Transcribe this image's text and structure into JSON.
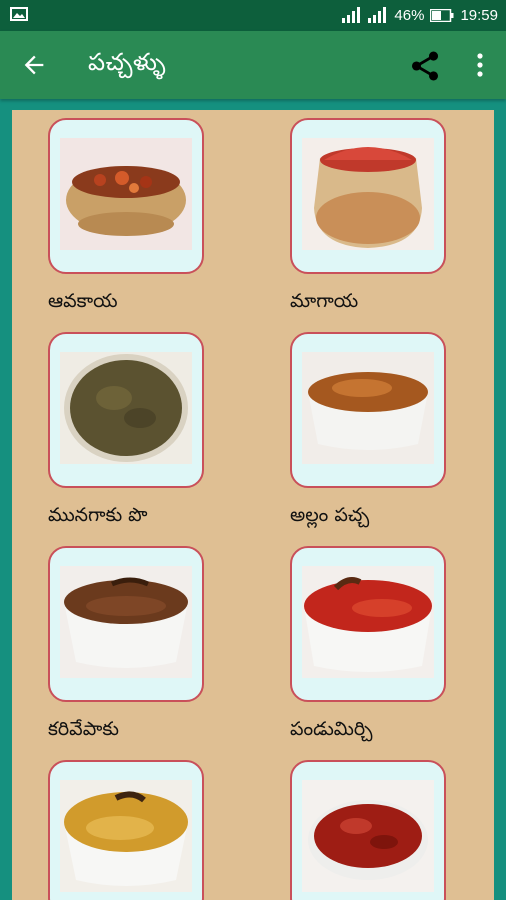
{
  "status_bar": {
    "battery": "46%",
    "time": "19:59"
  },
  "app_bar": {
    "title": "పచ్చళ్ళు"
  },
  "items": [
    {
      "label": "ఆవకాయ",
      "image": "clay-pot-pickle"
    },
    {
      "label": "మాగాయ",
      "image": "red-pickle-jar"
    },
    {
      "label": "మునగాకు పొ",
      "image": "powder-plate"
    },
    {
      "label": "అల్లం పచ్చ",
      "image": "ginger-chutney-bowl"
    },
    {
      "label": "కరివేపాకు",
      "image": "curry-leaf-pickle-bowl"
    },
    {
      "label": "పండుమిర్చి",
      "image": "red-chilli-pickle-bowl"
    },
    {
      "label": "",
      "image": "yellow-pickle-bowl"
    },
    {
      "label": "",
      "image": "mango-pickle-bowl"
    }
  ],
  "colors": {
    "status_bar": "#0d5f3c",
    "app_bar": "#2a8a54",
    "frame": "#15907f",
    "panel": "#dfbf93",
    "card_bg": "#dff7f7",
    "card_border": "#c9505a"
  }
}
